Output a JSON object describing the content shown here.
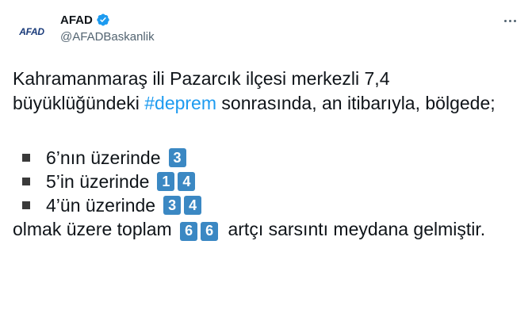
{
  "author": {
    "display_name": "AFAD",
    "handle": "@AFADBaskanlik",
    "logo_text": "AFAD",
    "verified_color": "#1d9bf0"
  },
  "tweet": {
    "intro_part1": "Kahramanmaraş ili Pazarcık ilçesi merkezli 7,4 büyüklüğündeki ",
    "hashtag": "#deprem",
    "intro_part2": " sonrasında, an itibarıyla, bölgede;",
    "items": [
      {
        "label": "6’nın üzerinde",
        "digits": [
          "3"
        ]
      },
      {
        "label": "5’in üzerinde",
        "digits": [
          "1",
          "4"
        ]
      },
      {
        "label": "4’ün üzerinde",
        "digits": [
          "3",
          "4"
        ]
      }
    ],
    "closing_part1": "olmak üzere toplam ",
    "total_digits": [
      "6",
      "6"
    ],
    "closing_part2": " artçı sarsıntı meydana gelmiştir."
  },
  "colors": {
    "link": "#1d9bf0",
    "keycap": "#3b88c3",
    "text": "#0f1419",
    "muted": "#536471"
  }
}
